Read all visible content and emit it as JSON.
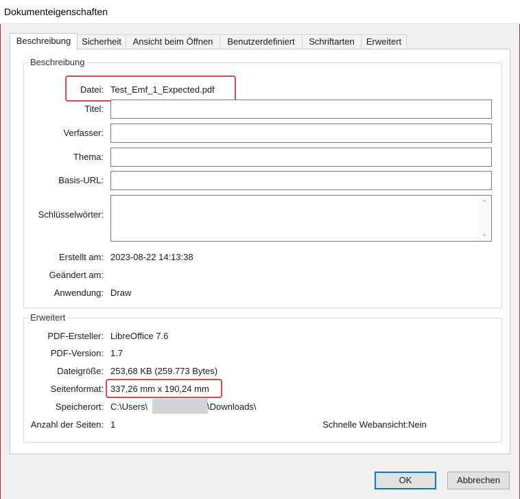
{
  "window": {
    "title": "Dokumenteigenschaften"
  },
  "tabs": [
    {
      "label": "Beschreibung",
      "active": true
    },
    {
      "label": "Sicherheit"
    },
    {
      "label": "Ansicht beim Öffnen"
    },
    {
      "label": "Benutzerdefiniert"
    },
    {
      "label": "Schriftarten"
    },
    {
      "label": "Erweitert"
    }
  ],
  "beschreibung": {
    "group_title": "Beschreibung",
    "datei_label": "Datei:",
    "datei_value": "Test_Emf_1_Expected.pdf",
    "titel_label": "Titel:",
    "titel_value": "",
    "verfasser_label": "Verfasser:",
    "verfasser_value": "",
    "thema_label": "Thema:",
    "thema_value": "",
    "basisurl_label": "Basis-URL:",
    "basisurl_value": "",
    "schluessel_label": "Schlüsselwörter:",
    "schluessel_value": "",
    "erstellt_label": "Erstellt am:",
    "erstellt_value": "2023-08-22 14:13:38",
    "geaendert_label": "Geändert am:",
    "geaendert_value": "",
    "anwendung_label": "Anwendung:",
    "anwendung_value": "Draw"
  },
  "erweitert": {
    "group_title": "Erweitert",
    "ersteller_label": "PDF-Ersteller:",
    "ersteller_value": "LibreOffice 7.6",
    "version_label": "PDF-Version:",
    "version_value": "1.7",
    "groesse_label": "Dateigröße:",
    "groesse_value": "253,68 KB (259.773 Bytes)",
    "format_label": "Seitenformat:",
    "format_value": "337,26 mm x 190,24 mm",
    "speicher_label": "Speicherort:",
    "speicher_prefix": "C:\\Users\\",
    "speicher_suffix": "\\Downloads\\",
    "seiten_label": "Anzahl der Seiten:",
    "seiten_value": "1",
    "webansicht_label": "Schnelle Webansicht:",
    "webansicht_value": "Nein"
  },
  "buttons": {
    "ok": "OK",
    "cancel": "Abbrechen"
  },
  "colors": {
    "highlight": "#e0474c",
    "accent": "#0078d7"
  },
  "icons": {
    "scroll_up": "chevron-up-icon",
    "scroll_down": "chevron-down-icon"
  }
}
